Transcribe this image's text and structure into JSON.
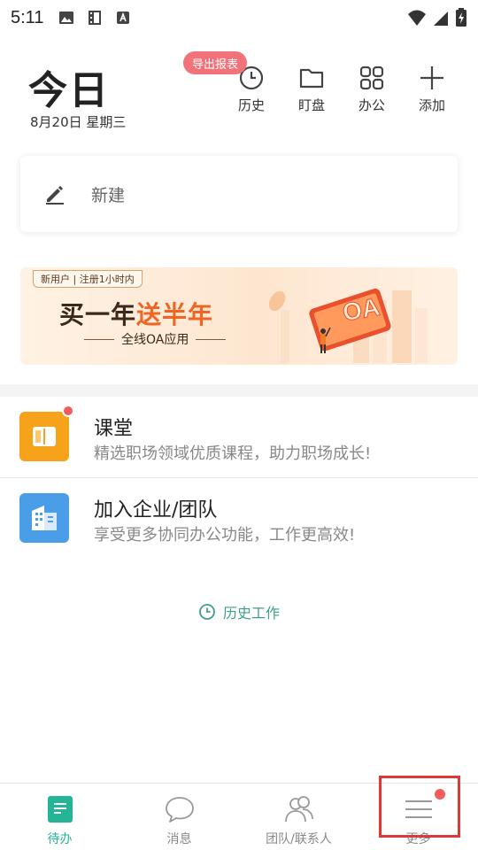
{
  "status_bar": {
    "time": "5:11"
  },
  "header": {
    "title": "今日",
    "date": "8月20日 星期三",
    "export_badge": "导出报表"
  },
  "toolbar": [
    {
      "label": "历史",
      "icon": "clock-icon"
    },
    {
      "label": "盯盘",
      "icon": "folder-icon"
    },
    {
      "label": "办公",
      "icon": "grid-apps-icon"
    },
    {
      "label": "添加",
      "icon": "plus-icon"
    }
  ],
  "new_card": {
    "label": "新建",
    "icon": "pencil-icon"
  },
  "banner": {
    "tag": "新用户 | 注册1小时内",
    "main_prefix": "买一年",
    "main_accent": "送半年",
    "sub": "全线OA应用",
    "art_text": "OA"
  },
  "list": [
    {
      "title": "课堂",
      "desc": "精选职场领域优质课程，助力职场成长!",
      "icon": "book-icon",
      "color": "#f7a21b",
      "badge": true
    },
    {
      "title": "加入企业/团队",
      "desc": "享受更多协同办公功能，工作更高效!",
      "icon": "building-icon",
      "color": "#4a9ee8",
      "badge": false
    }
  ],
  "history_link": {
    "label": "历史工作"
  },
  "bottom_nav": [
    {
      "label": "待办",
      "icon": "todo-document-icon",
      "active": true
    },
    {
      "label": "消息",
      "icon": "chat-bubble-icon",
      "active": false
    },
    {
      "label": "团队/联系人",
      "icon": "people-icon",
      "active": false
    },
    {
      "label": "更多",
      "icon": "menu-icon",
      "active": false,
      "badge": true
    }
  ],
  "colors": {
    "accent": "#23b596",
    "badge_red": "#f25c5c",
    "export_badge": "#f2727a",
    "highlight_box": "#dc3a3a"
  }
}
